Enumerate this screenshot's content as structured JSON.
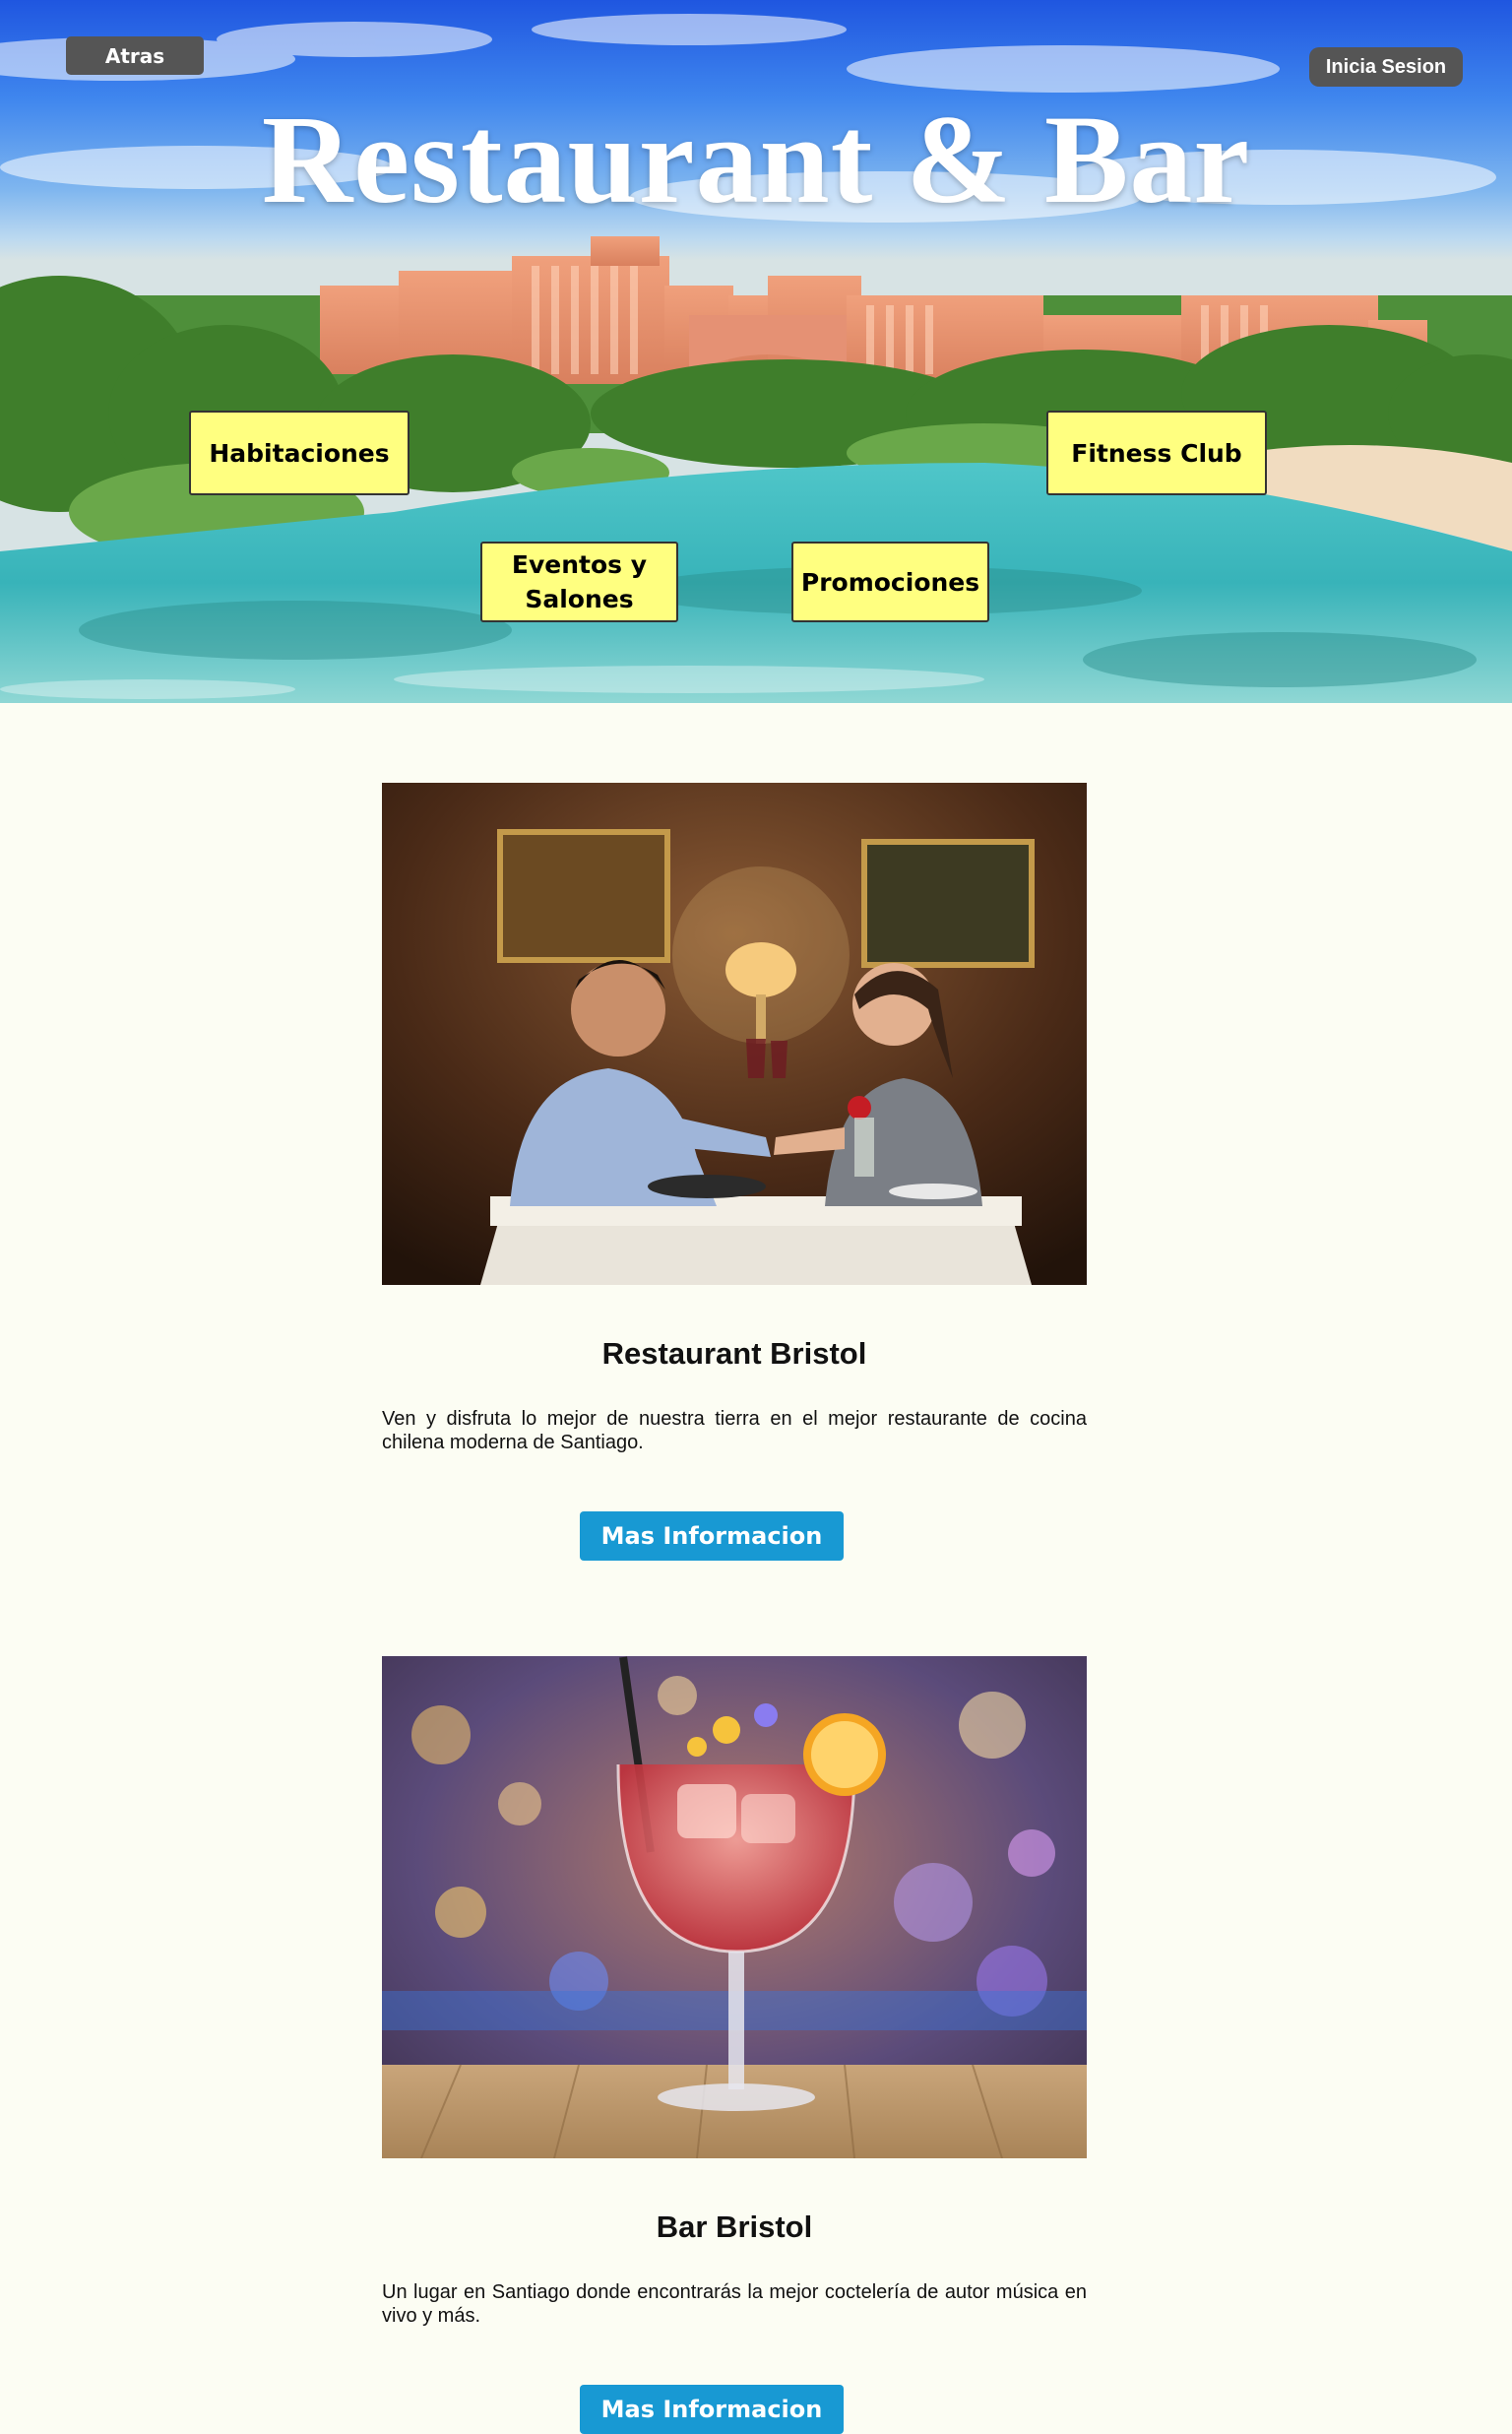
{
  "header": {
    "back_label": "Atras",
    "login_label": "Inicia Sesion",
    "title": "Restaurant & Bar"
  },
  "nav": {
    "habitaciones": "Habitaciones",
    "fitness": "Fitness Club",
    "eventos": "Eventos y Salones",
    "promociones": "Promociones"
  },
  "sections": [
    {
      "title": "Restaurant Bristol",
      "description": "Ven y disfruta lo mejor de nuestra tierra en el mejor restaurante de cocina chilena moderna de Santiago.",
      "button_label": "Mas Informacion"
    },
    {
      "title": "Bar Bristol",
      "description": "Un lugar en Santiago donde encontrarás la mejor coctelería de autor música en vivo y más.",
      "button_label": "Mas Informacion"
    }
  ],
  "colors": {
    "page_background": "#fcfdf3",
    "nav_box": "#ffff80",
    "dark_button": "#555555",
    "info_button": "#1899d3"
  }
}
